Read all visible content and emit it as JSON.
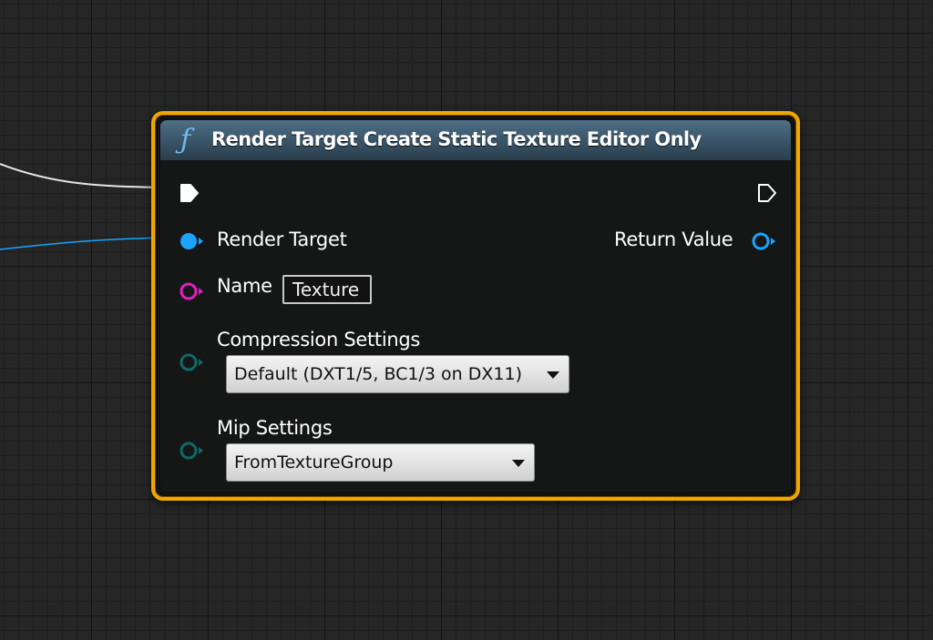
{
  "node": {
    "title": "Render Target Create Static Texture Editor Only",
    "icon": "function-icon",
    "function_glyph": "ƒ",
    "border_color": "#f0a800",
    "header_color": "#3c586c"
  },
  "pins": {
    "exec_in": {
      "type": "exec",
      "connected": true
    },
    "exec_out": {
      "type": "exec",
      "connected": false
    },
    "render_target": {
      "label": "Render Target",
      "color": "#1aa3ff",
      "connected": true
    },
    "return_value": {
      "label": "Return Value",
      "color": "#1aa3ff",
      "connected": false
    },
    "name": {
      "label": "Name",
      "value": "Texture",
      "color": "#e020c0",
      "connected": false
    },
    "compression_settings": {
      "label": "Compression Settings",
      "value": "Default (DXT1/5, BC1/3 on DX11)",
      "color": "#0f6a66",
      "connected": false
    },
    "mip_settings": {
      "label": "Mip Settings",
      "value": "FromTextureGroup",
      "color": "#0f6a66",
      "connected": false
    }
  },
  "wires": {
    "exec_color": "#e6e6e6",
    "object_color": "#1aa3ff"
  }
}
